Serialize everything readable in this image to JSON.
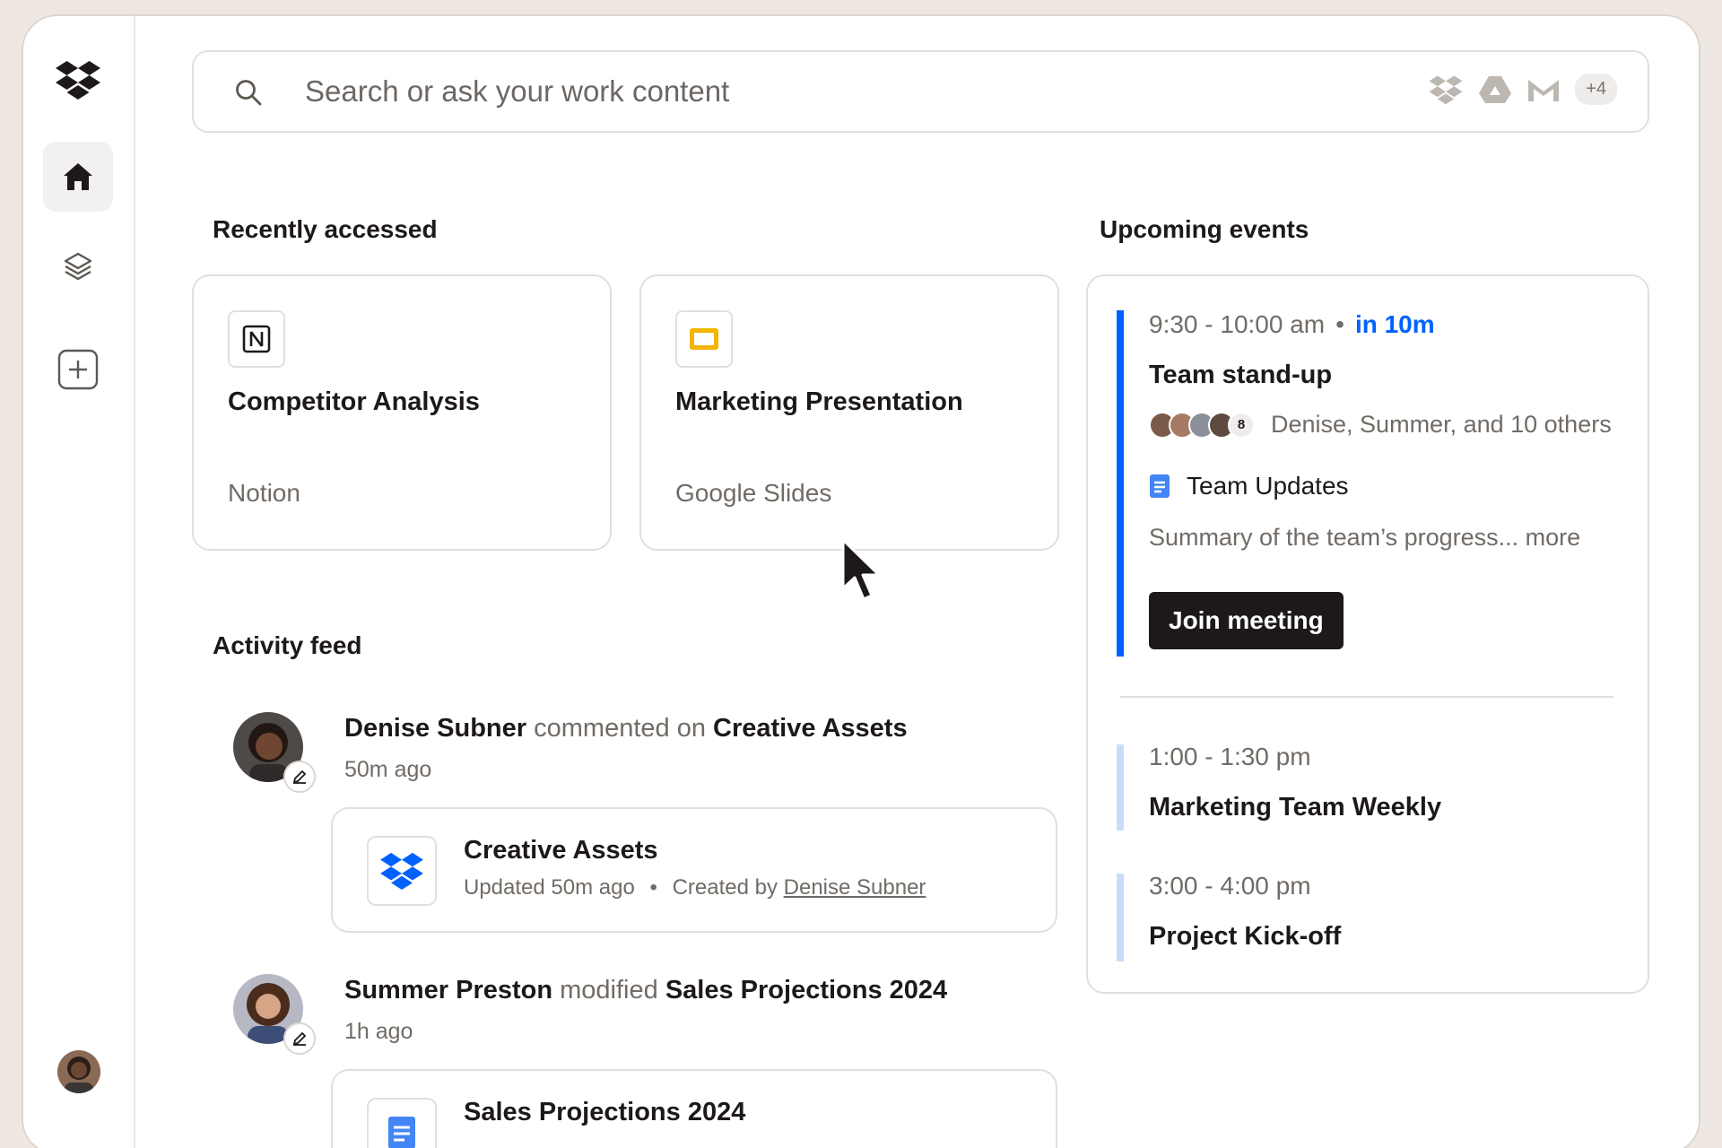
{
  "search": {
    "placeholder": "Search or ask your work content",
    "extra_sources": "+4"
  },
  "recent": {
    "title": "Recently accessed",
    "items": [
      {
        "title": "Competitor Analysis",
        "source": "Notion",
        "icon": "notion-icon"
      },
      {
        "title": "Marketing Presentation",
        "source": "Google Slides",
        "icon": "google-slides-icon"
      }
    ]
  },
  "activity": {
    "title": "Activity feed",
    "items": [
      {
        "user": "Denise Subner",
        "action": "commented on",
        "target": "Creative Assets",
        "time": "50m ago",
        "file": {
          "title": "Creative Assets",
          "updated": "Updated 50m ago",
          "created_prefix": "Created by",
          "created_by": "Denise Subner",
          "icon": "dropbox-icon"
        }
      },
      {
        "user": "Summer Preston",
        "action": "modified",
        "target": "Sales Projections 2024",
        "time": "1h ago",
        "file": {
          "title": "Sales Projections 2024",
          "icon": "google-docs-icon"
        }
      }
    ]
  },
  "events": {
    "title": "Upcoming events",
    "items": [
      {
        "time": "9:30 - 10:00 am",
        "soon": "in 10m",
        "title": "Team stand-up",
        "attendees_count": "8",
        "attendees_text": "Denise, Summer, and 10 others",
        "doc": "Team Updates",
        "summary": "Summary of the team’s progress... more",
        "join_label": "Join meeting",
        "accent": "#0061fe"
      },
      {
        "time": "1:00 - 1:30 pm",
        "title": "Marketing Team Weekly",
        "accent": "#c9dcfb"
      },
      {
        "time": "3:00 - 4:00 pm",
        "title": "Project Kick-off",
        "accent": "#c9dcfb"
      }
    ]
  }
}
